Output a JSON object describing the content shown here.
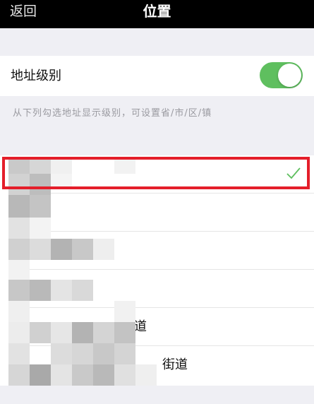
{
  "navbar": {
    "back_label": "返回",
    "title": "位置"
  },
  "address_level": {
    "label": "地址级别",
    "toggle_on": true,
    "hint": "从下列勾选地址显示级别，可设置省/市/区/镇"
  },
  "levels": [
    {
      "label": "",
      "selected": true
    },
    {
      "label": "",
      "selected": false
    },
    {
      "label": "",
      "selected": false
    },
    {
      "label": "",
      "selected": false
    },
    {
      "label": "道",
      "selected": false
    },
    {
      "label": "街道",
      "selected": false
    }
  ],
  "colors": {
    "toggle_on": "#5fbf5f",
    "checkmark": "#5fbf5f",
    "highlight_border": "#e41e2a"
  }
}
